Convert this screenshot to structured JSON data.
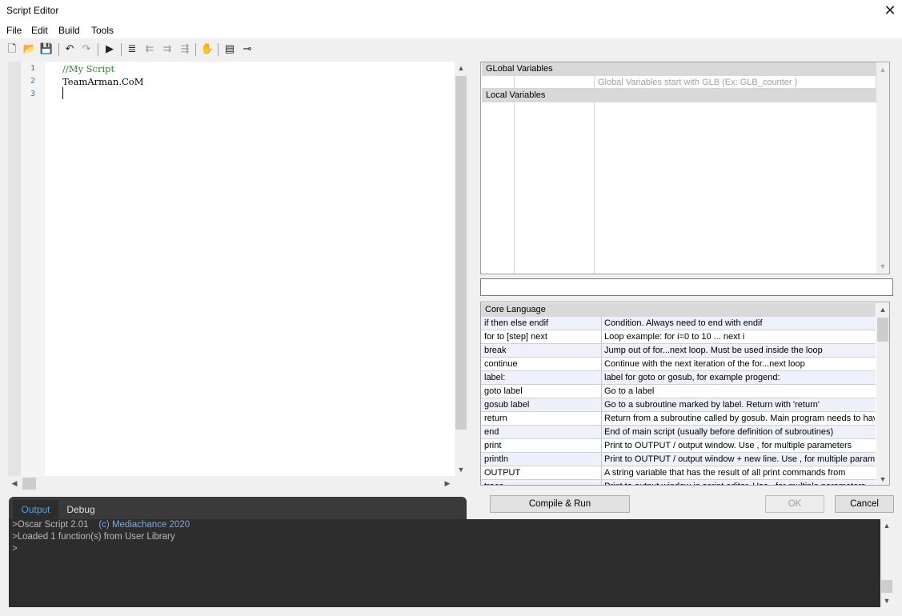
{
  "window": {
    "title": "Script Editor"
  },
  "menu": [
    "File",
    "Edit",
    "Build",
    "Tools"
  ],
  "editor": {
    "lines": [
      {
        "num": "1",
        "text": "//My Script",
        "color": "#2e8b2e"
      },
      {
        "num": "2",
        "text": "TeamArman.CoM",
        "color": "#000000"
      },
      {
        "num": "3",
        "text": "",
        "color": "#000000"
      }
    ]
  },
  "variables": {
    "global_header": "GLobal Variables",
    "global_hint": "Global Variables start with GLB  (Ex: GLB_counter )",
    "local_header": "Local Variables"
  },
  "core": {
    "header": "Core Language",
    "rows": [
      {
        "kw": "if then else endif",
        "desc": "Condition. Always need to end with endif"
      },
      {
        "kw": "for to [step] next",
        "desc": "Loop example: for i=0 to 10 ... next i"
      },
      {
        "kw": "break",
        "desc": "Jump out of for...next loop. Must be used inside the loop"
      },
      {
        "kw": "continue",
        "desc": "Continue with the next iteration of the for...next loop"
      },
      {
        "kw": "label:",
        "desc": "label for goto or gosub, for example progend:"
      },
      {
        "kw": "goto label",
        "desc": "Go to a label"
      },
      {
        "kw": "gosub label",
        "desc": "Go to a subroutine marked by label. Return with 'return'"
      },
      {
        "kw": "return",
        "desc": "Return from a subroutine called by gosub. Main program needs to have"
      },
      {
        "kw": "end",
        "desc": "End of main script (usually before definition of subroutines)"
      },
      {
        "kw": "print",
        "desc": "Print to OUTPUT / output window. Use , for multiple parameters"
      },
      {
        "kw": "println",
        "desc": "Print to OUTPUT / output window + new line. Use , for multiple parameters"
      },
      {
        "kw": "OUTPUT",
        "desc": "A string variable that has the result of all print commands from"
      },
      {
        "kw": "trace",
        "desc": "Print to output window in script editor. Use , for multiple parameters"
      }
    ]
  },
  "buttons": {
    "compile": "Compile & Run",
    "ok": "OK",
    "cancel": "Cancel"
  },
  "tabs": {
    "output": "Output",
    "debug": "Debug"
  },
  "console": {
    "prompt": ">",
    "line1_a": "Oscar Script 2.01",
    "line1_b": "(c) Mediachance 2020",
    "line1_b_color": "#7aa8e0",
    "line2": "Loaded 1 function(s) from User Library",
    "line3": ""
  }
}
